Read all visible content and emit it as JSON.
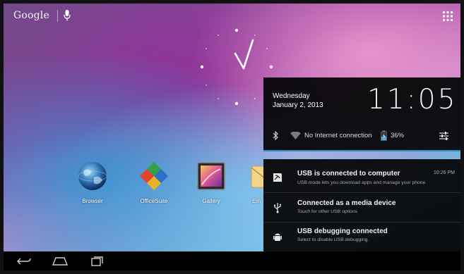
{
  "search": {
    "brand": "Google",
    "mic_icon": "microphone-icon"
  },
  "apps_icon": "app-drawer-icon",
  "apps": [
    {
      "label": "Browser",
      "icon": "browser-globe-icon"
    },
    {
      "label": "OfficeSuite",
      "icon": "officesuite-icon"
    },
    {
      "label": "Gallery",
      "icon": "gallery-icon"
    },
    {
      "label": "Em",
      "icon": "email-icon"
    }
  ],
  "notification_header": {
    "day": "Wednesday",
    "date": "January 2, 2013",
    "time": "11:05",
    "network": "No Internet connection",
    "battery": "36%"
  },
  "notifications": [
    {
      "title": "USB is connected to computer",
      "subtitle": "USB mode lets you download apps and manage your phone",
      "time": "10:26 PM",
      "icon": "usb-connected-icon"
    },
    {
      "title": "Connected as a media device",
      "subtitle": "Touch for other USB options",
      "time": "",
      "icon": "usb-icon"
    },
    {
      "title": "USB debugging connected",
      "subtitle": "Select to disable USB debugging.",
      "time": "",
      "icon": "android-debug-icon"
    }
  ],
  "colors": {
    "accent": "#2a8ecb",
    "panel": "#08080a",
    "navbar": "#000000"
  }
}
